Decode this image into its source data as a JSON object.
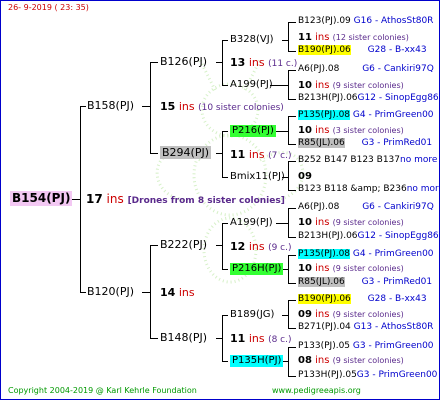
{
  "header": {
    "date": "26- 9-2019 ( 23: 35)"
  },
  "footer": {
    "copyright": "Copyright 2004-2019 @ Karl Kehrle Foundation",
    "website": "www.pedigreeapis.org"
  },
  "colors": {
    "pink": "#f3c8f3",
    "yellow": "#ffff00",
    "cyan": "#00ffff",
    "green": "#33ff33",
    "gray": "#c0c0c0",
    "blue": "#0000cc",
    "red": "#cc0000"
  },
  "root": {
    "id": "B154(PJ)",
    "ins_count": "17",
    "ins_label": "ins",
    "note": "[Drones from 8 sister colonies]"
  },
  "gen1": [
    {
      "id": "B158(PJ)",
      "ins_count": "15",
      "ins_label": "ins",
      "note": "(10 sister colonies)"
    },
    {
      "id": "B120(PJ)",
      "ins_count": "14",
      "ins_label": "ins"
    }
  ],
  "gen2": [
    {
      "id": "B126(PJ)",
      "ins_count": "13",
      "ins_label": "ins",
      "note": "(11 c.)"
    },
    {
      "id": "B294(PJ)",
      "ins_count": "11",
      "ins_label": "ins",
      "note": "(7 c.)"
    },
    {
      "id": "B222(PJ)",
      "ins_count": "12",
      "ins_label": "ins",
      "note": "(9 c.)"
    },
    {
      "id": "B148(PJ)",
      "ins_count": "11",
      "ins_label": "ins",
      "note": "(8 c.)"
    }
  ],
  "gen3": [
    {
      "id": "B328(VJ)",
      "ins_count": "11",
      "ins_label": "ins",
      "note": "(12 sister colonies)"
    },
    {
      "id": "A199(PJ)",
      "ins_count": "10",
      "ins_label": "ins",
      "note": "(9 sister colonies)"
    },
    {
      "id": "P216(PJ)",
      "ins_count": "10",
      "ins_label": "ins",
      "note": "(3 sister colonies)"
    },
    {
      "id": "Bmix11(PJ)",
      "ins_count": "09",
      "ins_label": ""
    },
    {
      "id": "A199(PJ)",
      "ins_count": "10",
      "ins_label": "ins",
      "note": "(9 sister colonies)"
    },
    {
      "id": "P216H(PJ)",
      "ins_count": "10",
      "ins_label": "ins",
      "note": "(9 sister colonies)"
    },
    {
      "id": "B189(JG)",
      "ins_count": "09",
      "ins_label": "ins",
      "note": "(9 sister colonies)"
    },
    {
      "id": "P135H(PJ)",
      "ins_count": "08",
      "ins_label": "ins",
      "note": "(9 sister colonies)"
    }
  ],
  "gen4": [
    {
      "id": "B123(PJ).09",
      "info": "G16 - AthosSt80R"
    },
    {
      "id": "B190(PJ).06",
      "info": "G28 - B-xx43"
    },
    {
      "id": "A6(PJ).08",
      "info": "G6 - Cankiri97Q"
    },
    {
      "id": "B213H(PJ).06",
      "info": "G12 - SinopEgg86R"
    },
    {
      "id": "P135(PJ).08",
      "info": "G4 - PrimGreen00"
    },
    {
      "id": "R85(JL).06",
      "info": "G3 - PrimRed01"
    },
    {
      "id": "B252 B147 B123 B137",
      "info": "no more"
    },
    {
      "id": "B123 B118 &amp; B236",
      "info": "no more"
    },
    {
      "id": "A6(PJ).08",
      "info": "G6 - Cankiri97Q"
    },
    {
      "id": "B213H(PJ).06",
      "info": "G12 - SinopEgg86R"
    },
    {
      "id": "P135(PJ).08",
      "info": "G4 - PrimGreen00"
    },
    {
      "id": "R85(JL).06",
      "info": "G3 - PrimRed01"
    },
    {
      "id": "B190(PJ).06",
      "info": "G28 - B-xx43"
    },
    {
      "id": "B271(PJ).04",
      "info": "G13 - AthosSt80R"
    },
    {
      "id": "P133(PJ).05",
      "info": "G3 - PrimGreen00"
    },
    {
      "id": "P133H(PJ).05",
      "info": "G3 - PrimGreen00"
    }
  ]
}
